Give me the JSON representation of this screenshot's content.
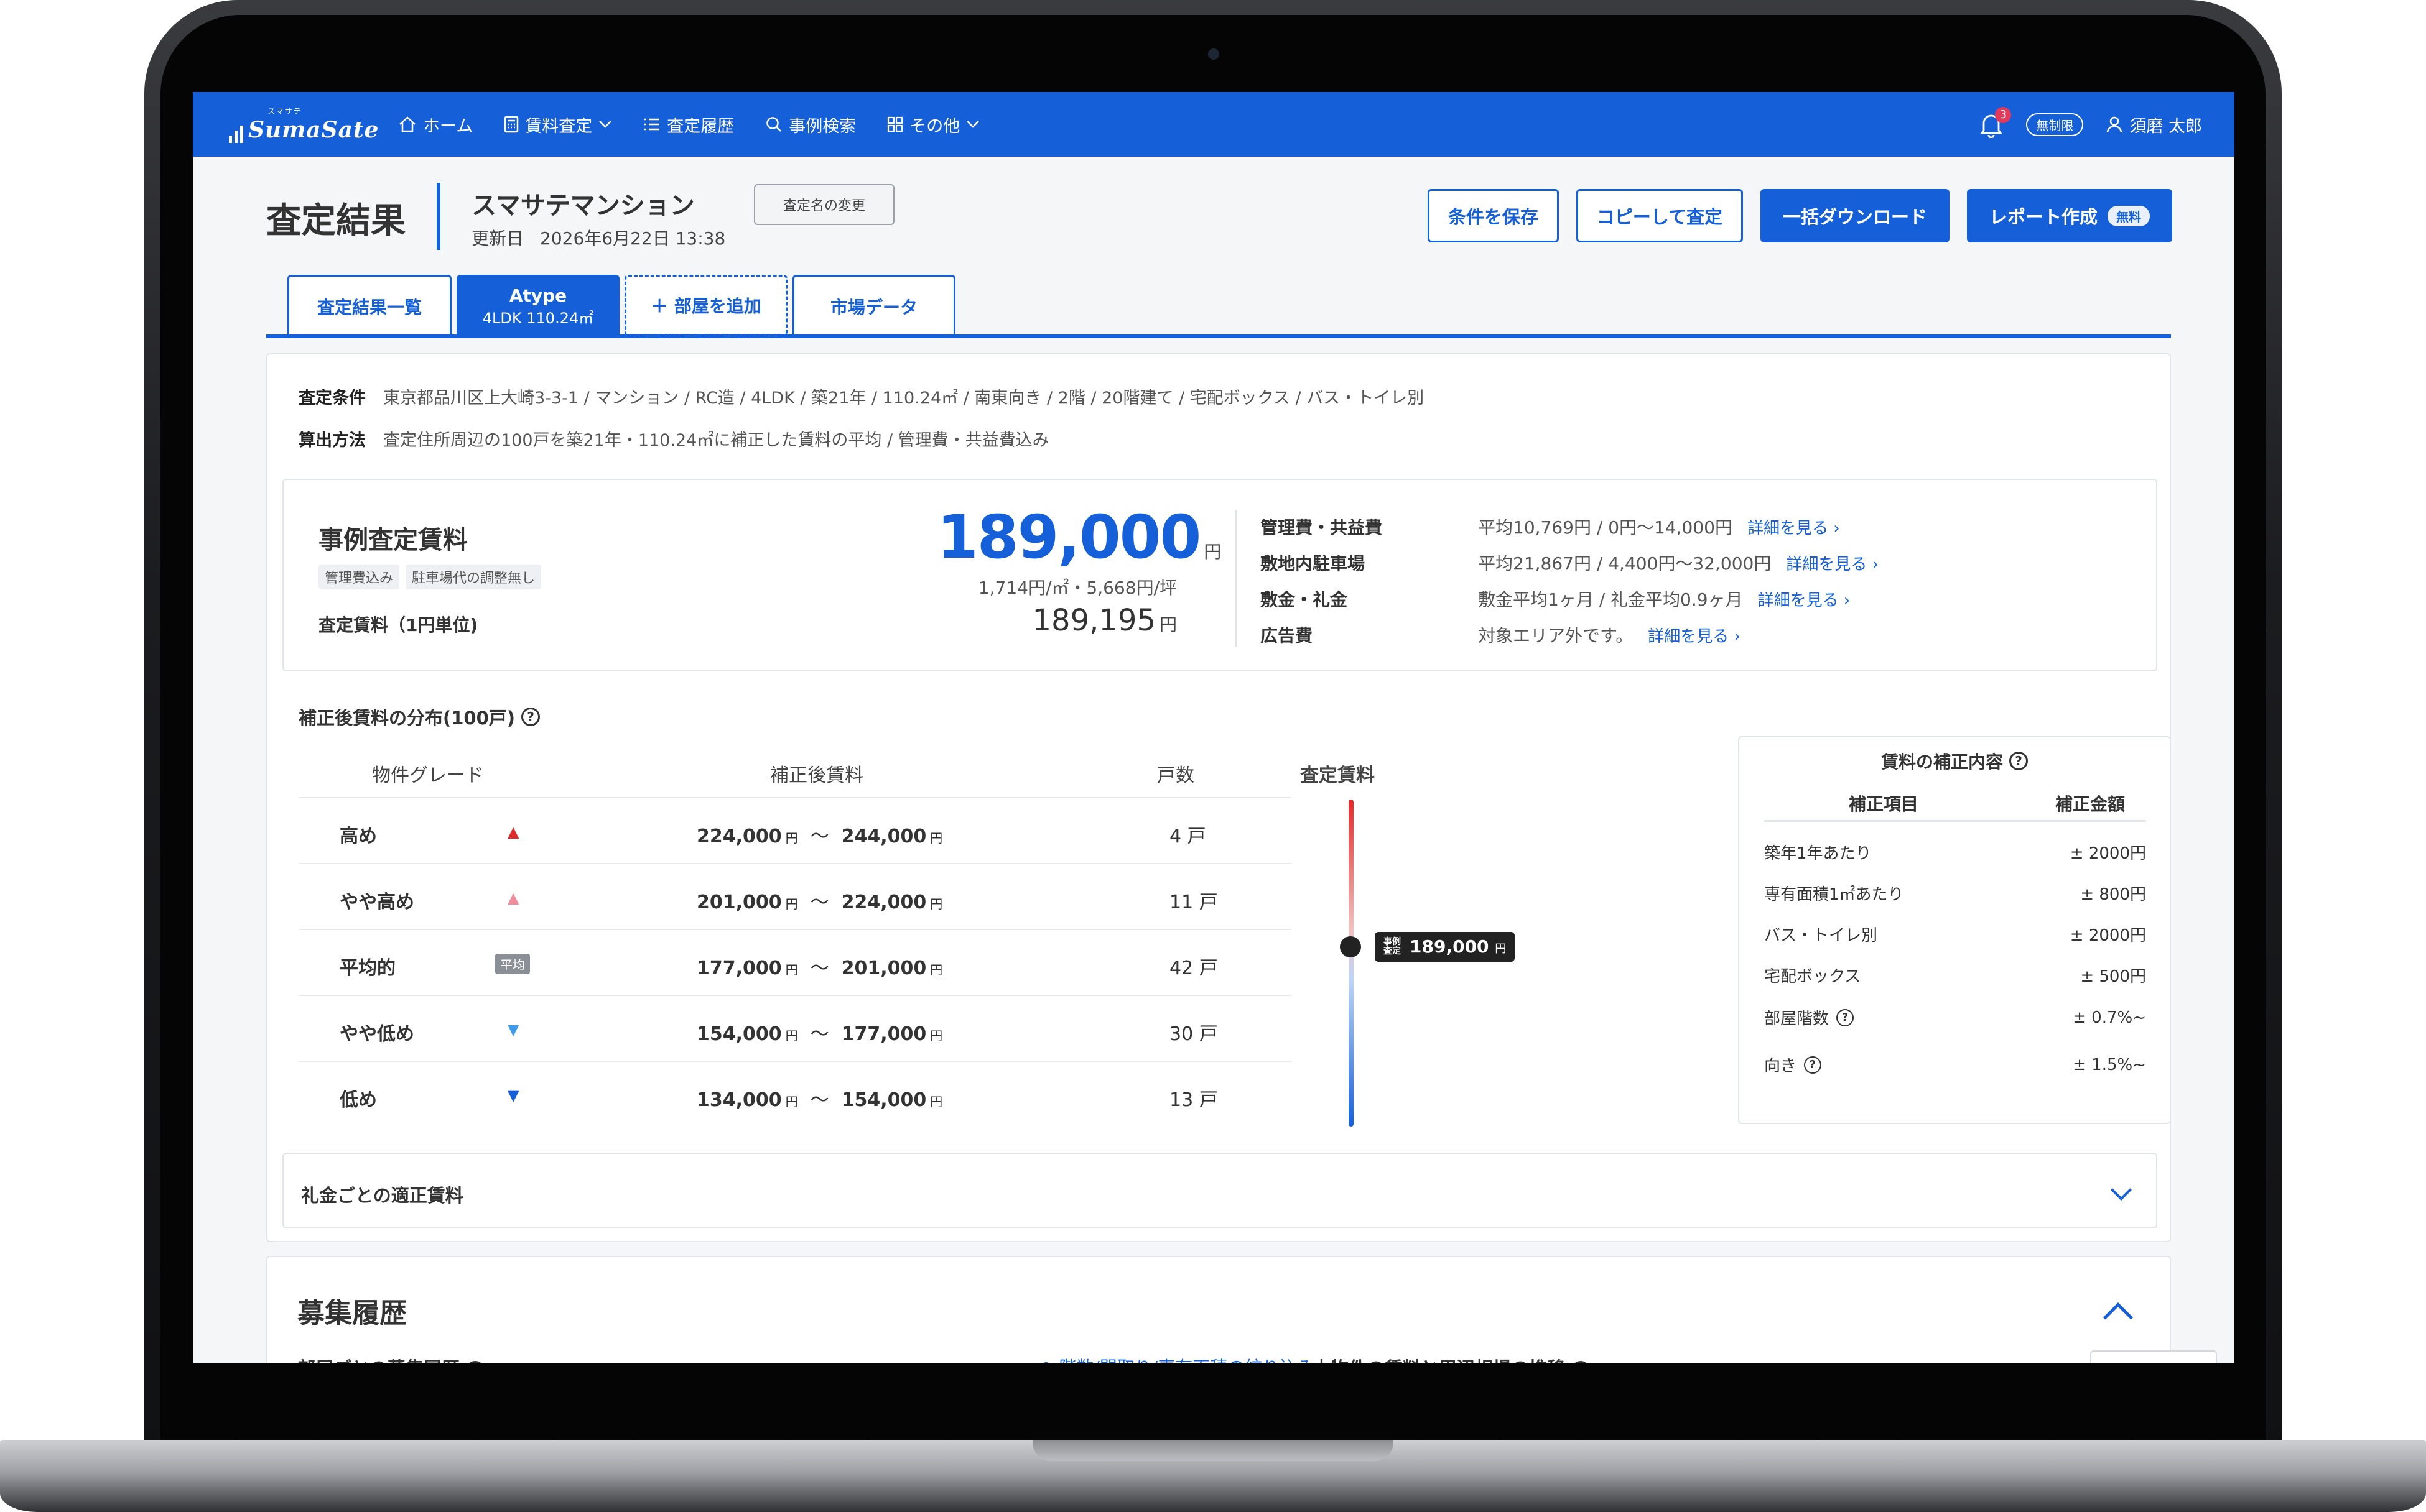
{
  "nav": {
    "logo_kana": "スマサテ",
    "logo_text": "SumaSate",
    "items": [
      {
        "label": "ホーム"
      },
      {
        "label": "賃料査定"
      },
      {
        "label": "査定履歴"
      },
      {
        "label": "事例検索"
      },
      {
        "label": "その他"
      }
    ],
    "notification_count": "3",
    "plan": "無制限",
    "user_name": "須磨 太郎"
  },
  "header": {
    "page_title": "査定結果",
    "property_name": "スマサテマンション",
    "updated_label": "更新日",
    "updated_value": "2026年6月22日 13:38",
    "rename_label": "査定名の変更",
    "save_label": "条件を保存",
    "copy_label": "コピーして査定",
    "download_label": "一括ダウンロード",
    "report_label": "レポート作成",
    "report_badge": "無料"
  },
  "tabs": [
    {
      "label": "査定結果一覧"
    },
    {
      "label": "Atype",
      "sub": "4LDK 110.24㎡"
    },
    {
      "label": "＋ 部屋を追加"
    },
    {
      "label": "市場データ"
    }
  ],
  "conditions": {
    "cond_label": "査定条件",
    "cond_value": "東京都品川区上大崎3-3-1 / マンション / RC造 / 4LDK / 築21年 / 110.24㎡ / 南東向き / 2階 / 20階建て / 宅配ボックス / バス・トイレ別",
    "method_label": "算出方法",
    "method_value": "査定住所周辺の100戸を築21年・110.24㎡に補正した賃料の平均 / 管理費・共益費込み"
  },
  "rent": {
    "title": "事例査定賃料",
    "tag1": "管理費込み",
    "tag2": "駐車場代の調整無し",
    "unit_label": "査定賃料（1円単位)",
    "main_value": "189,000",
    "yen": "円",
    "unit_price": "1,714円/㎡・5,668円/坪",
    "exact_value": "189,195",
    "fees": [
      {
        "label": "管理費・共益費",
        "value": "平均10,769円 / 0円〜14,000円",
        "link": "詳細を見る ›"
      },
      {
        "label": "敷地内駐車場",
        "value": "平均21,867円 / 4,400円〜32,000円",
        "link": "詳細を見る ›"
      },
      {
        "label": "敷金・礼金",
        "value": "敷金平均1ヶ月 / 礼金平均0.9ヶ月",
        "link": "詳細を見る ›"
      },
      {
        "label": "広告費",
        "value": "対象エリア外です。",
        "link": "詳細を見る ›"
      }
    ]
  },
  "distribution": {
    "title": "補正後賃料の分布(100戸)",
    "col_grade": "物件グレード",
    "col_rent": "補正後賃料",
    "col_count": "戸数",
    "col_gauge": "査定賃料",
    "avg_badge": "平均",
    "yen": "円",
    "tilde": "〜",
    "rows": [
      {
        "grade": "高め",
        "from": "224,000",
        "to": "244,000",
        "count": "4 戸"
      },
      {
        "grade": "やや高め",
        "from": "201,000",
        "to": "224,000",
        "count": "11 戸"
      },
      {
        "grade": "平均的",
        "from": "177,000",
        "to": "201,000",
        "count": "42 戸"
      },
      {
        "grade": "やや低め",
        "from": "154,000",
        "to": "177,000",
        "count": "30 戸"
      },
      {
        "grade": "低め",
        "from": "134,000",
        "to": "154,000",
        "count": "13 戸"
      }
    ],
    "gauge_tag_1": "事例",
    "gauge_tag_2": "査定",
    "gauge_value": "189,000",
    "gauge_yen": "円",
    "gauge_position": 0.45
  },
  "adjustment": {
    "title": "賃料の補正内容",
    "col_item": "補正項目",
    "col_amount": "補正金額",
    "rows": [
      {
        "item": "築年1年あたり",
        "amount": "± 2000円"
      },
      {
        "item": "専有面積1㎡あたり",
        "amount": "± 800円"
      },
      {
        "item": "バス・トイレ別",
        "amount": "± 2000円"
      },
      {
        "item": "宅配ボックス",
        "amount": "± 500円"
      },
      {
        "item": "部屋階数",
        "amount": "± 0.7%~"
      },
      {
        "item": "向き",
        "amount": "± 1.5%~"
      }
    ]
  },
  "reikin": {
    "title": "礼金ごとの適正賃料"
  },
  "history": {
    "title": "募集履歴",
    "sub_left": "部屋ごとの募集履歴",
    "filter_link": "階数/間取り/専有面積の絞り込み",
    "sub_right": "本物件の賃料と周辺相場の推移"
  },
  "colors": {
    "brand": "#1560d8",
    "high": "#e02b2b",
    "slightly_high": "#f08f9b",
    "slightly_low": "#3d9be9",
    "low": "#1560d8"
  }
}
